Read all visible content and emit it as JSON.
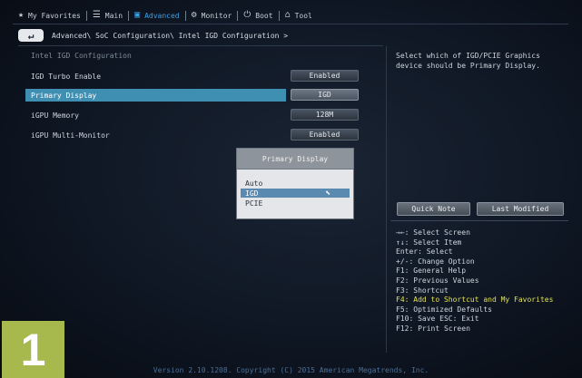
{
  "nav": {
    "items": [
      {
        "label": "My Favorites",
        "icon": "star-icon",
        "glyph": "★"
      },
      {
        "label": "Main",
        "icon": "list-icon",
        "glyph": "☰"
      },
      {
        "label": "Advanced",
        "icon": "advanced-icon",
        "glyph": "▣"
      },
      {
        "label": "Monitor",
        "icon": "monitor-icon",
        "glyph": "⚙"
      },
      {
        "label": "Boot",
        "icon": "power-icon",
        "glyph": "⏻"
      },
      {
        "label": "Tool",
        "icon": "tool-icon",
        "glyph": "⌂"
      }
    ],
    "active": "Advanced"
  },
  "breadcrumb": {
    "back_icon": "↵",
    "path": "Advanced\\ SoC Configuration\\ Intel IGD Configuration >"
  },
  "main": {
    "section_title": "Intel IGD Configuration",
    "rows": [
      {
        "label": "IGD Turbo Enable",
        "value": "Enabled"
      },
      {
        "label": "Primary Display",
        "value": "IGD"
      },
      {
        "label": "iGPU Memory",
        "value": "128M"
      },
      {
        "label": "iGPU Multi-Monitor",
        "value": "Enabled"
      }
    ]
  },
  "popup": {
    "title": "Primary Display",
    "options": [
      "Auto",
      "IGD",
      "PCIE"
    ],
    "selected": "IGD"
  },
  "help": {
    "text": "Select which of IGD/PCIE Graphics device should be Primary Display."
  },
  "buttons": {
    "quick_note": "Quick Note",
    "last_modified": "Last Modified"
  },
  "keys": [
    "→←: Select Screen",
    "↑↓: Select Item",
    "Enter: Select",
    "+/-: Change Option",
    "F1: General Help",
    "F2: Previous Values",
    "F3: Shortcut",
    "F4: Add to Shortcut and My Favorites",
    "F5: Optimized Defaults",
    "F10: Save  ESC: Exit",
    "F12: Print Screen"
  ],
  "footer": "Version 2.10.1208. Copyright (C) 2015 American Megatrends, Inc.",
  "badge": "1",
  "colors": {
    "accent": "#3aa0e6",
    "selected_row": "#3f8fb2",
    "highlight_key": "#e2e055",
    "badge": "#a7b84d"
  }
}
